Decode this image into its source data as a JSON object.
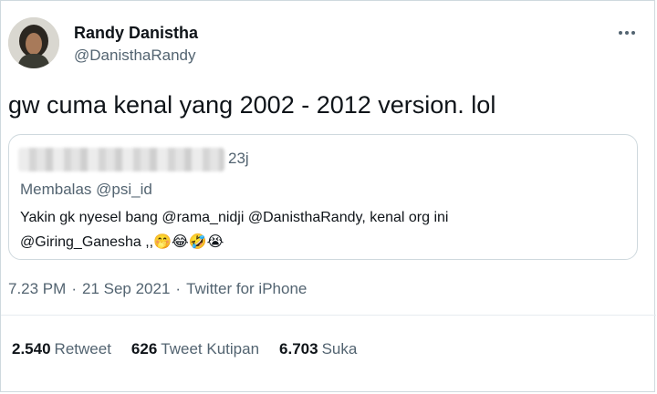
{
  "author": {
    "display_name": "Randy Danistha",
    "handle": "@DanisthaRandy"
  },
  "tweet": {
    "text": "gw cuma kenal yang 2002 - 2012 version. lol"
  },
  "quoted": {
    "time": "23j",
    "replying_to": "Membalas @psi_id",
    "body_line1": "Yakin gk nyesel bang @rama_nidji @DanisthaRandy, kenal org ini",
    "body_line2": "@Giring_Ganesha ,,",
    "emojis": "🤭😂🤣😭"
  },
  "meta": {
    "time": "7.23 PM",
    "date": "21 Sep 2021",
    "source": "Twitter for iPhone",
    "dot": "·"
  },
  "stats": [
    {
      "value": "2.540",
      "label": "Retweet"
    },
    {
      "value": "626",
      "label": "Tweet Kutipan"
    },
    {
      "value": "6.703",
      "label": "Suka"
    }
  ],
  "icons": {
    "more": "more-horizontal-icon"
  },
  "colors": {
    "text": "#0f1419",
    "secondary": "#536471",
    "border": "#cfd9de"
  }
}
